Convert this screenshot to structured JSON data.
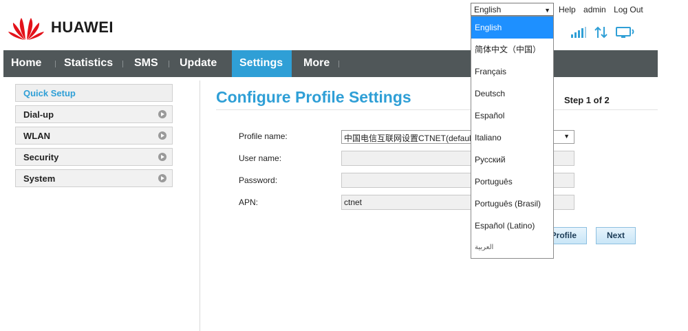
{
  "header": {
    "language_selected": "English",
    "links": {
      "help": "Help",
      "admin": "admin",
      "logout": "Log Out"
    },
    "brand": "HUAWEI"
  },
  "language_options": [
    "English",
    "简体中文（中国）",
    "Français",
    "Deutsch",
    "Español",
    "Italiano",
    "Русский",
    "Português",
    "Português (Brasil)",
    "Español (Latino)",
    "العربية"
  ],
  "nav": {
    "items": [
      "Home",
      "Statistics",
      "SMS",
      "Update",
      "Settings",
      "More"
    ],
    "active": "Settings"
  },
  "sidebar": {
    "items": [
      "Quick Setup",
      "Dial-up",
      "WLAN",
      "Security",
      "System"
    ],
    "active": "Quick Setup"
  },
  "main": {
    "title": "Configure Profile Settings",
    "step": "Step 1 of 2",
    "fields": {
      "profile_name_label": "Profile name:",
      "profile_name_value": "中国电信互联网设置CTNET(defaul",
      "user_name_label": "User name:",
      "user_name_value": "",
      "password_label": "Password:",
      "password_value": "",
      "apn_label": "APN:",
      "apn_value": "ctnet"
    },
    "buttons": {
      "new_profile": "Profile",
      "next": "Next"
    }
  },
  "colors": {
    "accent": "#2f9fd6",
    "nav_bg": "#505759",
    "dropdown_selected": "#1e90ff"
  },
  "icons": [
    "signal-icon",
    "data-transfer-icon",
    "device-icon",
    "huawei-logo-icon",
    "chevron-right-icon"
  ]
}
